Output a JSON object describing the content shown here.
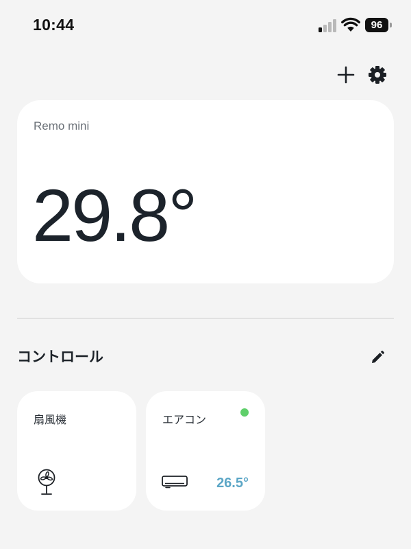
{
  "status_bar": {
    "time": "10:44",
    "battery_level": "96",
    "signal_icon": "cellular-signal-icon",
    "wifi_icon": "wifi-icon",
    "battery_icon": "battery-icon"
  },
  "header": {
    "add_icon": "plus-icon",
    "settings_icon": "gear-icon"
  },
  "sensor": {
    "device_name": "Remo mini",
    "temperature": "29.8°"
  },
  "controls": {
    "title": "コントロール",
    "edit_icon": "pencil-icon",
    "tiles": [
      {
        "label": "扇風機",
        "icon": "fan-icon"
      },
      {
        "label": "エアコン",
        "icon": "air-conditioner-icon",
        "status": "on",
        "status_color": "#5fcf6a",
        "temperature": "26.5°",
        "temperature_color": "#5ba6c6"
      }
    ]
  }
}
